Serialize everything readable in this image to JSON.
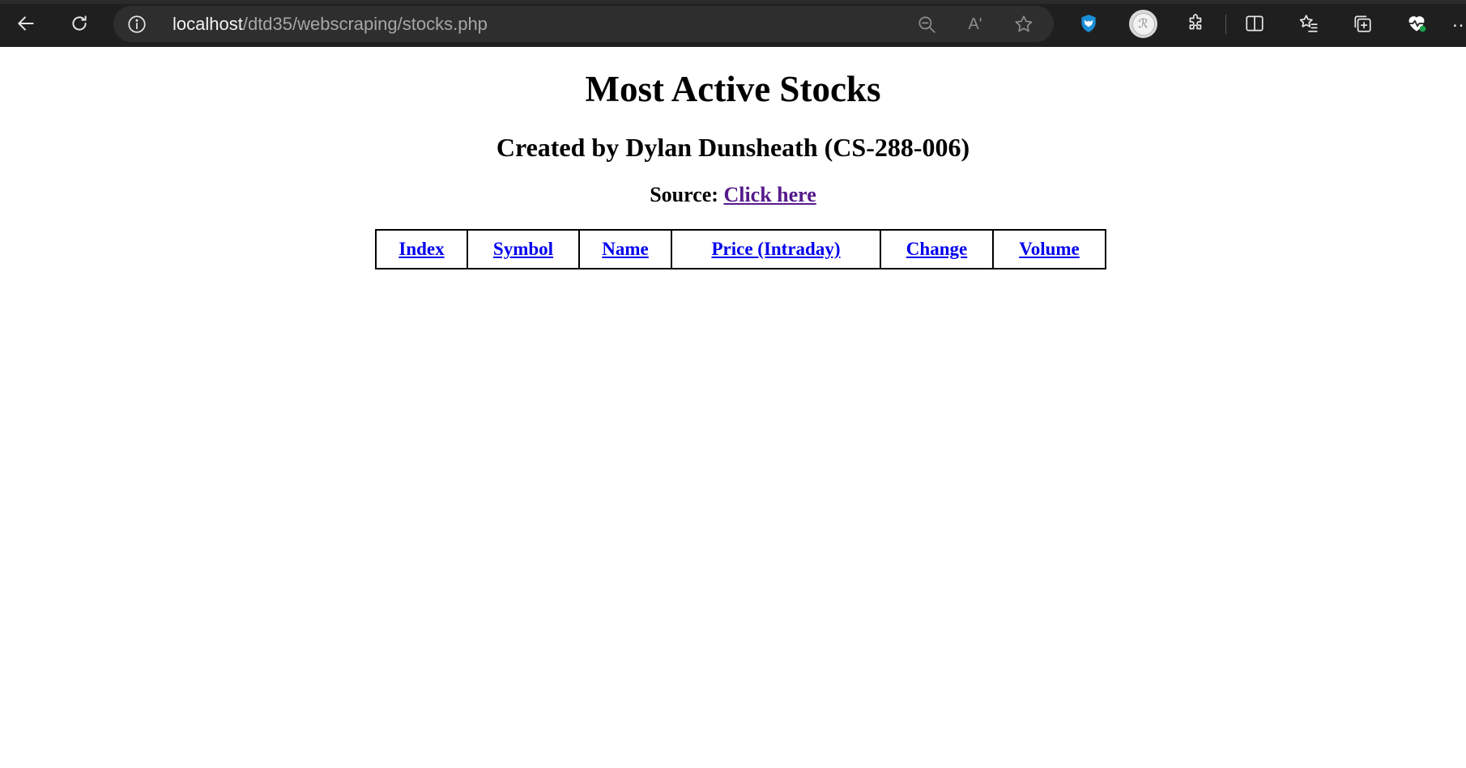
{
  "browser": {
    "url_host": "localhost",
    "url_path": "/dtd35/webscraping/stocks.php",
    "read_aloud_label": "Aʹ"
  },
  "page": {
    "title": "Most Active Stocks",
    "subtitle": "Created by Dylan Dunsheath (CS-288-006)",
    "source_label": "Source:",
    "source_link": "Click here"
  },
  "table": {
    "columns": [
      "Index",
      "Symbol",
      "Name",
      "Price (Intraday)",
      "Change",
      "Volume"
    ]
  },
  "colors": {
    "link": "#0000ee",
    "visited_link": "#551a8b",
    "toolbar": "#1f1f1f"
  }
}
